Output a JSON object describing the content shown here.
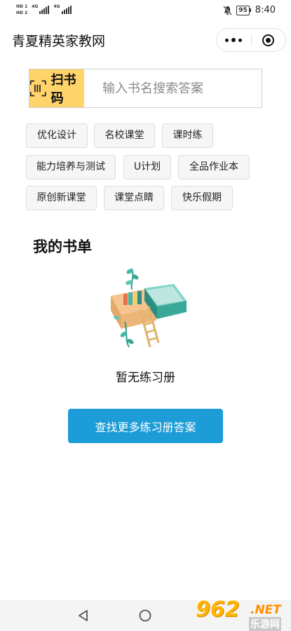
{
  "status_bar": {
    "sim1": [
      "HD",
      "1"
    ],
    "sim2": [
      "HD",
      "2"
    ],
    "net1": "4G",
    "net2": "4G",
    "battery": "95",
    "time": "8:40"
  },
  "header": {
    "title": "青夏精英家教网"
  },
  "search": {
    "scan_label": "扫书码",
    "placeholder": "输入书名搜索答案"
  },
  "categories": [
    "优化设计",
    "名校课堂",
    "课时练",
    "能力培养与测试",
    "U计划",
    "全品作业本",
    "原创新课堂",
    "课堂点睛",
    "快乐假期"
  ],
  "booklist": {
    "title": "我的书单",
    "empty_text": "暂无练习册",
    "button_label": "查找更多练习册答案"
  },
  "watermark": {
    "brand": "962",
    "suffix": ".NET",
    "name": "乐游网"
  },
  "colors": {
    "scan_bg": "#ffd46a",
    "primary": "#1d9dd8"
  }
}
